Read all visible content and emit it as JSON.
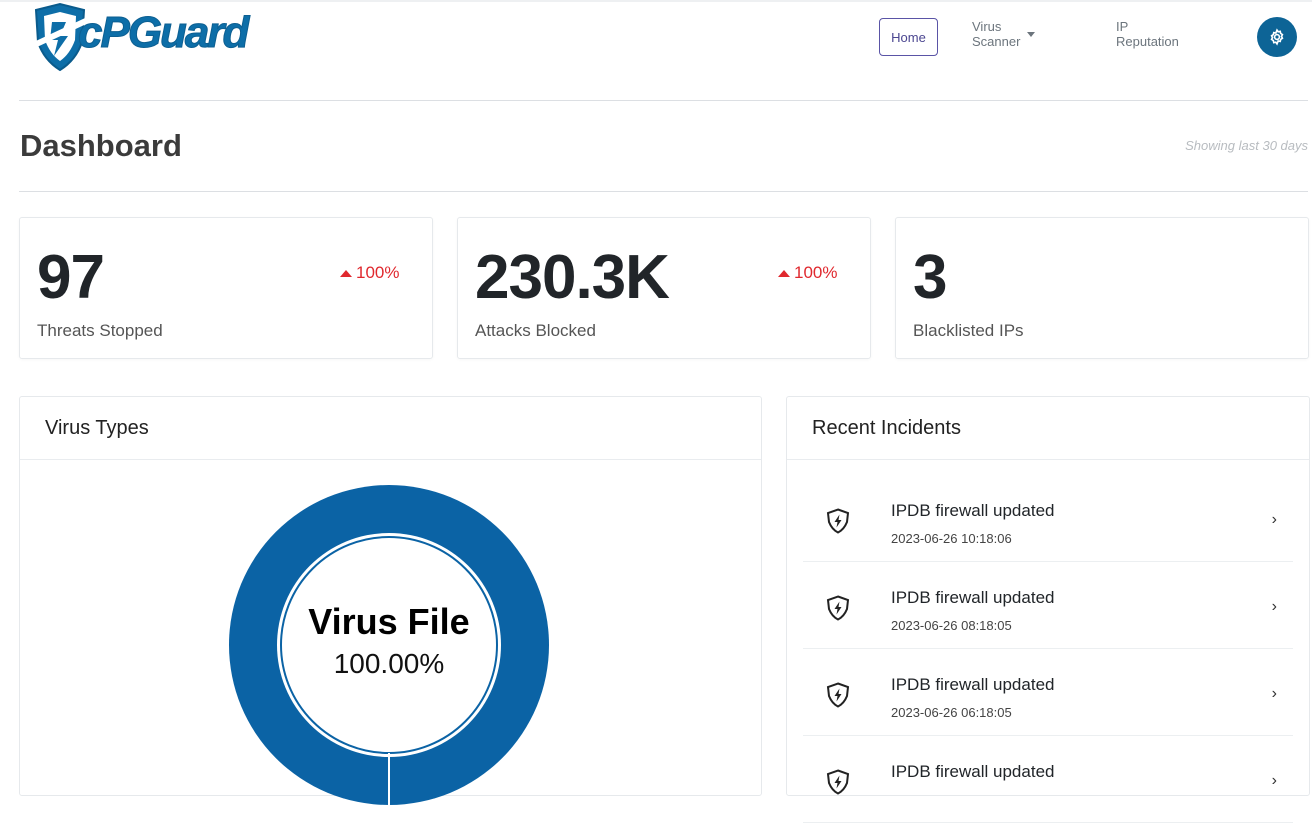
{
  "app": {
    "brand_logo_text": "cPGuard"
  },
  "nav": {
    "home": "Home",
    "virus_scanner": "Virus Scanner",
    "ip_reputation": "IP Reputation",
    "settings_icon": "gear-icon"
  },
  "page": {
    "title": "Dashboard",
    "range_note": "Showing last 30 days"
  },
  "stats": [
    {
      "value": "97",
      "label": "Threats Stopped",
      "change": "100%",
      "trend": "up"
    },
    {
      "value": "230.3K",
      "label": "Attacks Blocked",
      "change": "100%",
      "trend": "up"
    },
    {
      "value": "3",
      "label": "Blacklisted IPs"
    }
  ],
  "virus_types": {
    "title": "Virus Types",
    "segment_label": "Virus File",
    "segment_pct": "100.00%",
    "segment_color": "#0b63a5"
  },
  "incidents": {
    "title": "Recent Incidents",
    "items": [
      {
        "title": "IPDB firewall updated",
        "time": "2023-06-26 10:18:06",
        "icon": "shield-bolt-icon"
      },
      {
        "title": "IPDB firewall updated",
        "time": "2023-06-26 08:18:05",
        "icon": "shield-bolt-icon"
      },
      {
        "title": "IPDB firewall updated",
        "time": "2023-06-26 06:18:05",
        "icon": "shield-bolt-icon"
      },
      {
        "title": "IPDB firewall updated",
        "time": "",
        "icon": "shield-bolt-icon"
      }
    ]
  },
  "colors": {
    "brand": "#0d6496",
    "alert": "#e0282e",
    "nav_active": "#5a54a6"
  }
}
